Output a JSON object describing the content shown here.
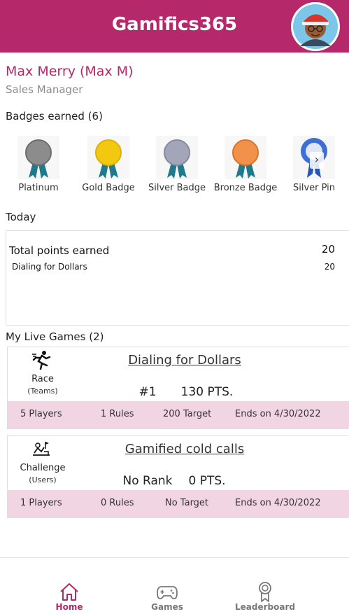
{
  "app": {
    "title": "Gamifics365"
  },
  "user": {
    "name": "Max Merry (Max M)",
    "role": "Sales Manager"
  },
  "badges": {
    "heading": "Badges earned (6)",
    "items": [
      {
        "label": "Platinum",
        "color": "#8c8c8c",
        "icon": "medal-icon"
      },
      {
        "label": "Gold Badge",
        "color": "#f2c811",
        "icon": "medal-icon"
      },
      {
        "label": "Silver Badge",
        "color": "#a3a6b8",
        "icon": "medal-icon"
      },
      {
        "label": "Bronze Badge",
        "color": "#f2924a",
        "icon": "medal-icon"
      },
      {
        "label": "Silver Pin",
        "color": "#3d6fd6",
        "icon": "ribbon-icon"
      }
    ]
  },
  "today": {
    "heading": "Today",
    "total_label": "Total points earned",
    "total_value": "20",
    "items": [
      {
        "label": "Dialing for Dollars",
        "value": "20"
      }
    ]
  },
  "live_games": {
    "heading": "My Live Games (2)",
    "games": [
      {
        "title": "Dialing for Dollars",
        "type": "Race",
        "sub": "(Teams)",
        "icon": "runner-icon",
        "rank": "#1",
        "points": "130 PTS.",
        "players": "5 Players",
        "rules": "1 Rules",
        "target": "200 Target",
        "ends": "Ends on 4/30/2022"
      },
      {
        "title": "Gamified cold calls",
        "type": "Challenge",
        "sub": "(Users)",
        "icon": "challenge-icon",
        "rank": "No Rank",
        "points": "0 PTS.",
        "players": "1 Players",
        "rules": "0 Rules",
        "target": "No Target",
        "ends": "Ends on 4/30/2022"
      }
    ]
  },
  "nav": {
    "items": [
      {
        "label": "Home",
        "icon": "home-icon",
        "active": true
      },
      {
        "label": "Games",
        "icon": "gamepad-icon",
        "active": false
      },
      {
        "label": "Leaderboard",
        "icon": "award-icon",
        "active": false
      }
    ]
  },
  "colors": {
    "brand": "#b5286a",
    "footer_band": "#f2d5e3"
  }
}
